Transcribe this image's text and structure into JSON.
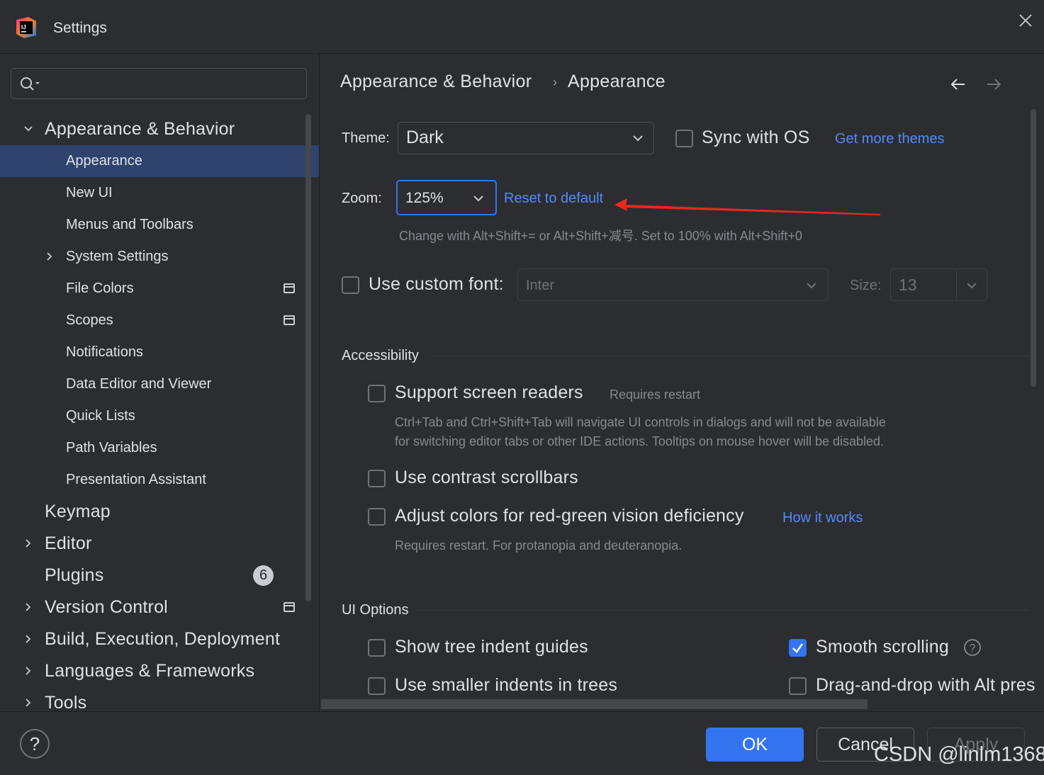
{
  "window": {
    "title": "Settings",
    "logo_text": "IJ"
  },
  "sidebar": {
    "search": {
      "value": "",
      "placeholder": ""
    },
    "items": [
      {
        "label": "Appearance & Behavior",
        "level": 0,
        "expanded": true
      },
      {
        "label": "Appearance",
        "level": 1,
        "selected": true
      },
      {
        "label": "New UI",
        "level": 1
      },
      {
        "label": "Menus and Toolbars",
        "level": 1
      },
      {
        "label": "System Settings",
        "level": 1,
        "collapsed": true
      },
      {
        "label": "File Colors",
        "level": 1,
        "project_icon": true
      },
      {
        "label": "Scopes",
        "level": 1,
        "project_icon": true
      },
      {
        "label": "Notifications",
        "level": 1
      },
      {
        "label": "Data Editor and Viewer",
        "level": 1
      },
      {
        "label": "Quick Lists",
        "level": 1
      },
      {
        "label": "Path Variables",
        "level": 1
      },
      {
        "label": "Presentation Assistant",
        "level": 1
      },
      {
        "label": "Keymap",
        "level": 0
      },
      {
        "label": "Editor",
        "level": 0,
        "collapsed": true
      },
      {
        "label": "Plugins",
        "level": 0,
        "badge": "6"
      },
      {
        "label": "Version Control",
        "level": 0,
        "collapsed": true,
        "project_icon": true
      },
      {
        "label": "Build, Execution, Deployment",
        "level": 0,
        "collapsed": true
      },
      {
        "label": "Languages & Frameworks",
        "level": 0,
        "collapsed": true
      },
      {
        "label": "Tools",
        "level": 0,
        "collapsed": true
      }
    ]
  },
  "breadcrumb": {
    "parent": "Appearance & Behavior",
    "separator": "›",
    "current": "Appearance"
  },
  "theme": {
    "label": "Theme:",
    "value": "Dark",
    "sync_label": "Sync with OS",
    "sync_checked": false,
    "more_link": "Get more themes"
  },
  "zoom": {
    "label": "Zoom:",
    "value": "125%",
    "reset_link": "Reset to default",
    "hint": "Change with Alt+Shift+= or Alt+Shift+减号. Set to 100% with Alt+Shift+0"
  },
  "font": {
    "label": "Use custom font:",
    "checked": false,
    "value": "Inter",
    "size_label": "Size:",
    "size_value": "13"
  },
  "accessibility": {
    "title": "Accessibility",
    "screen_readers": {
      "label": "Support screen readers",
      "note": "Requires restart",
      "checked": false,
      "hint1": "Ctrl+Tab and Ctrl+Shift+Tab will navigate UI controls in dialogs and will not be available",
      "hint2": "for switching editor tabs or other IDE actions. Tooltips on mouse hover will be disabled."
    },
    "contrast": {
      "label": "Use contrast scrollbars",
      "checked": false
    },
    "color_adjust": {
      "label": "Adjust colors for red-green vision deficiency",
      "checked": false,
      "link": "How it works",
      "hint": "Requires restart. For protanopia and deuteranopia."
    }
  },
  "ui_options": {
    "title": "UI Options",
    "tree_guides": {
      "label": "Show tree indent guides",
      "checked": false
    },
    "smaller_indents": {
      "label": "Use smaller indents in trees",
      "checked": false
    },
    "smooth_scrolling": {
      "label": "Smooth scrolling",
      "checked": true
    },
    "drag_drop": {
      "label": "Drag-and-drop with Alt pres",
      "checked": false
    }
  },
  "footer": {
    "help": "?",
    "ok": "OK",
    "cancel": "Cancel",
    "apply": "Apply",
    "watermark": "CSDN @linlm1368"
  },
  "colors": {
    "accent": "#3574f0",
    "link": "#548af7",
    "selection": "#2e436e",
    "annotation_arrow": "#e8291f"
  }
}
